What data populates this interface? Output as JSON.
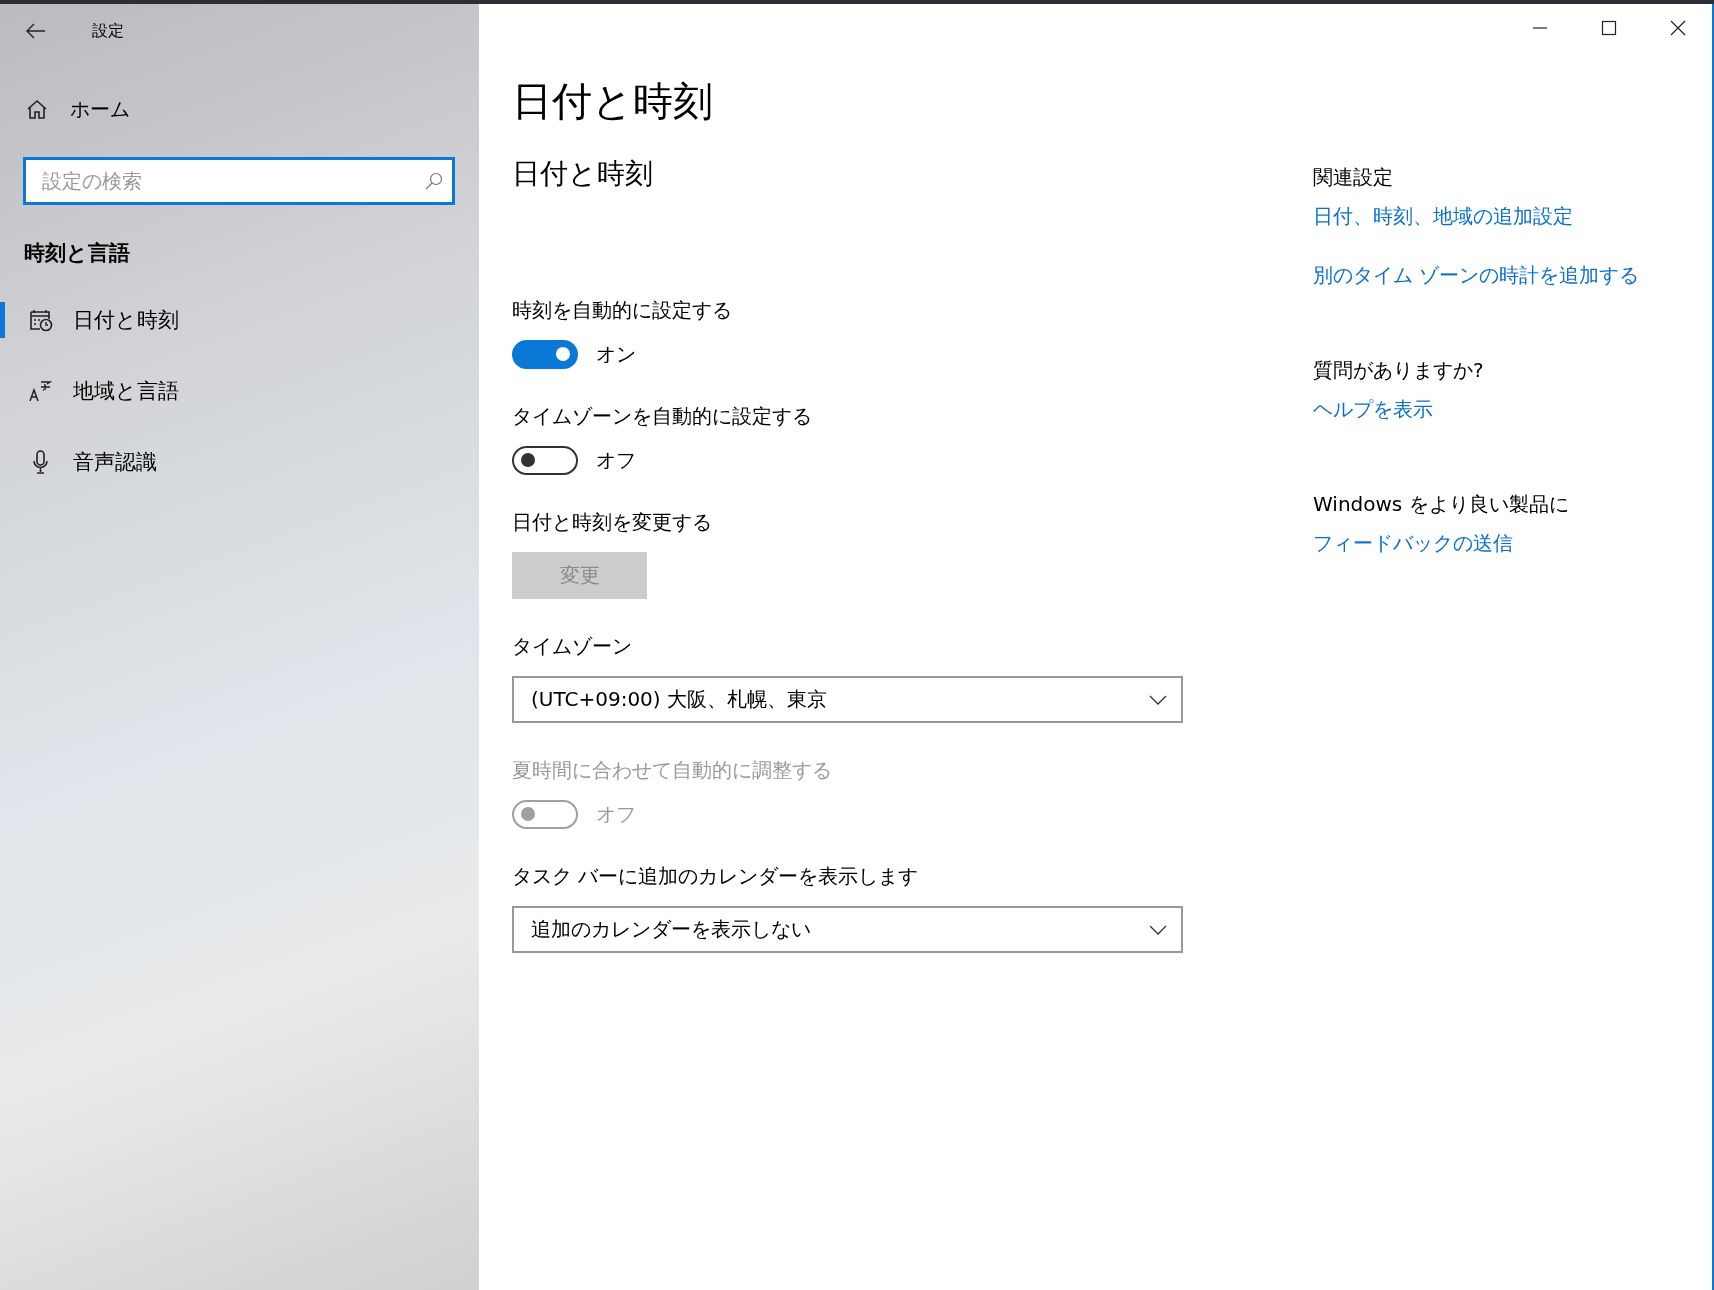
{
  "window": {
    "title": "設定"
  },
  "sidebar": {
    "home": "ホーム",
    "search": {
      "placeholder": "設定の検索"
    },
    "section": "時刻と言語",
    "items": [
      {
        "label": "日付と時刻",
        "kind": "calendar",
        "selected": true
      },
      {
        "label": "地域と言語",
        "kind": "language",
        "selected": false
      },
      {
        "label": "音声認識",
        "kind": "speech",
        "selected": false
      }
    ]
  },
  "page": {
    "title": "日付と時刻",
    "subtitle": "日付と時刻",
    "settings": [
      {
        "kind": "toggle",
        "label": "時刻を自動的に設定する",
        "on": true,
        "state_text": "オン",
        "disabled": false
      },
      {
        "kind": "toggle",
        "label": "タイムゾーンを自動的に設定する",
        "on": false,
        "state_text": "オフ",
        "disabled": false
      },
      {
        "kind": "button",
        "label": "日付と時刻を変更する",
        "button": "変更",
        "disabled": true
      },
      {
        "kind": "dropdown",
        "label": "タイムゾーン",
        "value": "(UTC+09:00) 大阪、札幌、東京"
      },
      {
        "kind": "toggle",
        "label": "夏時間に合わせて自動的に調整する",
        "on": false,
        "state_text": "オフ",
        "disabled": true
      },
      {
        "kind": "dropdown",
        "label": "タスク バーに追加のカレンダーを表示します",
        "value": "追加のカレンダーを表示しない"
      }
    ]
  },
  "related": [
    {
      "heading": "関連設定",
      "links": [
        "日付、時刻、地域の追加設定",
        "別のタイム ゾーンの時計を追加する"
      ]
    },
    {
      "heading": "質問がありますか?",
      "links": [
        "ヘルプを表示"
      ]
    },
    {
      "heading": "Windows をより良い製品に",
      "links": [
        "フィードバックの送信"
      ]
    }
  ]
}
